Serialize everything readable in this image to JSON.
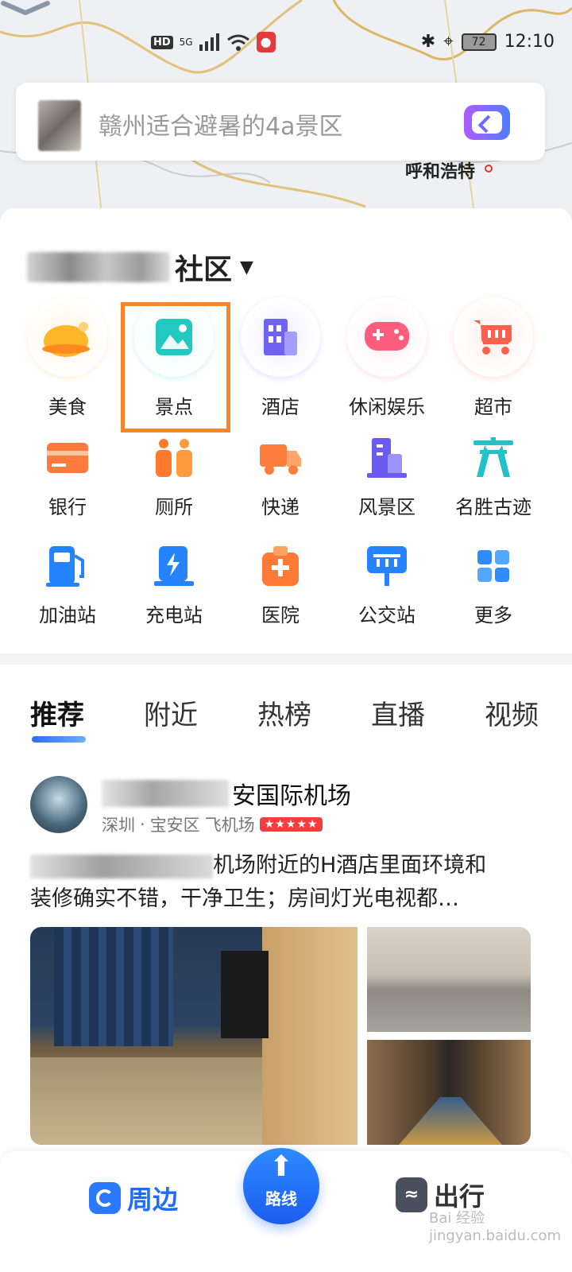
{
  "status_bar": {
    "hd": "HD",
    "network": "5G",
    "battery": "72",
    "time": "12:10"
  },
  "search": {
    "placeholder": "赣州适合避暑的4a景区"
  },
  "map": {
    "city_label": "呼和浩特"
  },
  "location": {
    "visible_suffix": "社区"
  },
  "categories": [
    {
      "label": "美食",
      "icon": "roast-chicken-icon",
      "color": "#ffb629"
    },
    {
      "label": "景点",
      "icon": "landscape-photo-icon",
      "color": "#22c9c0"
    },
    {
      "label": "酒店",
      "icon": "hotel-building-icon",
      "color": "#6e63f2"
    },
    {
      "label": "休闲娱乐",
      "icon": "gamepad-icon",
      "color": "#ff5d7d"
    },
    {
      "label": "超市",
      "icon": "shopping-cart-icon",
      "color": "#ff5f4d"
    },
    {
      "label": "银行",
      "icon": "bank-card-icon",
      "color": "#ff7a3d"
    },
    {
      "label": "厕所",
      "icon": "toilet-people-icon",
      "color": "#ff7a2f"
    },
    {
      "label": "快递",
      "icon": "delivery-truck-icon",
      "color": "#ff7d3b"
    },
    {
      "label": "风景区",
      "icon": "scenic-building-icon",
      "color": "#6a5cf0"
    },
    {
      "label": "名胜古迹",
      "icon": "ancient-gate-icon",
      "color": "#22c2c8"
    },
    {
      "label": "加油站",
      "icon": "gas-pump-icon",
      "color": "#2583ff"
    },
    {
      "label": "充电站",
      "icon": "charging-station-icon",
      "color": "#2583ff"
    },
    {
      "label": "医院",
      "icon": "hospital-icon",
      "color": "#ff7a36"
    },
    {
      "label": "公交站",
      "icon": "bus-stop-icon",
      "color": "#2583ff"
    },
    {
      "label": "更多",
      "icon": "more-grid-icon",
      "color": "#2e8cff"
    }
  ],
  "tabs": [
    "推荐",
    "附近",
    "热榜",
    "直播",
    "视频"
  ],
  "post": {
    "title_visible": "安国际机场",
    "meta_city": "深圳",
    "meta_district": "宝安区",
    "meta_tag": "飞机场",
    "stars": "★★★★★",
    "text_line1": "机场附近的H酒店里面环境和",
    "text_line2": "装修确实不错，干净卫生；房间灯光电视都…"
  },
  "bottom_nav": {
    "nearby": "周边",
    "route": "路线",
    "travel": "出行",
    "watermark": "Bai 经验 jingyan.baidu.com"
  }
}
